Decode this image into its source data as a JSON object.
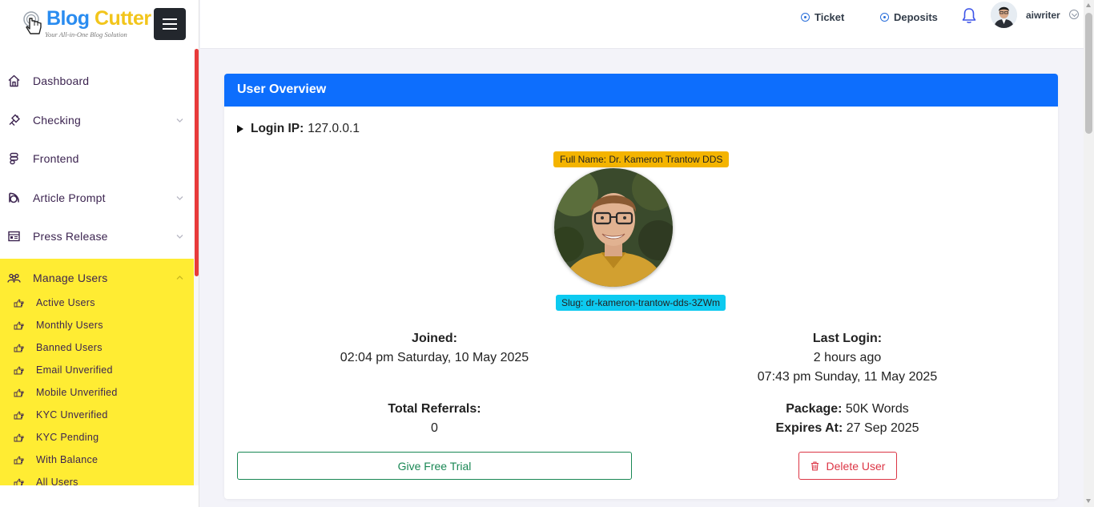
{
  "brand": {
    "name_part1": "Blog",
    "name_part2": "Cutter",
    "tagline": "Your All-in-One Blog Solution"
  },
  "sidebar": {
    "items": [
      {
        "label": "Dashboard",
        "icon": "home-icon"
      },
      {
        "label": "Checking",
        "icon": "checking-icon",
        "has_submenu": true
      },
      {
        "label": "Frontend",
        "icon": "frontend-icon"
      },
      {
        "label": "Article Prompt",
        "icon": "article-prompt-icon",
        "has_submenu": true
      },
      {
        "label": "Press Release",
        "icon": "press-release-icon",
        "has_submenu": true
      },
      {
        "label": "Manage Users",
        "icon": "users-icon",
        "has_submenu": true,
        "expanded": true
      }
    ],
    "manage_users_sub": [
      {
        "label": "Active Users"
      },
      {
        "label": "Monthly Users"
      },
      {
        "label": "Banned Users"
      },
      {
        "label": "Email Unverified"
      },
      {
        "label": "Mobile Unverified"
      },
      {
        "label": "KYC Unverified"
      },
      {
        "label": "KYC Pending"
      },
      {
        "label": "With Balance"
      },
      {
        "label": "All Users"
      }
    ],
    "active_bg": "#ffec33",
    "scroll_accent": "#e83a3a"
  },
  "topbar": {
    "ticket_label": "Ticket",
    "deposits_label": "Deposits",
    "username": "aiwriter"
  },
  "overview": {
    "title": "User Overview",
    "login_ip_label": "Login IP:",
    "login_ip_value": "127.0.0.1",
    "full_name_badge": "Full Name: Dr. Kameron Trantow DDS",
    "slug_badge": "Slug: dr-kameron-trantow-dds-3ZWm",
    "joined_label": "Joined:",
    "joined_value": "02:04 pm Saturday, 10 May 2025",
    "last_login_label": "Last Login:",
    "last_login_relative": "2 hours ago",
    "last_login_value": "07:43 pm Sunday, 11 May 2025",
    "total_referrals_label": "Total Referrals:",
    "total_referrals_value": "0",
    "package_label": "Package:",
    "package_value": "50K Words",
    "expires_label": "Expires At:",
    "expires_value": "27 Sep 2025",
    "trial_button": "Give Free Trial",
    "delete_button": "Delete User"
  },
  "colors": {
    "header_blue": "#0d6efd",
    "success_green": "#198754",
    "danger_red": "#dc3545",
    "name_badge": "#f4b400",
    "slug_badge": "#0dcaf0"
  }
}
